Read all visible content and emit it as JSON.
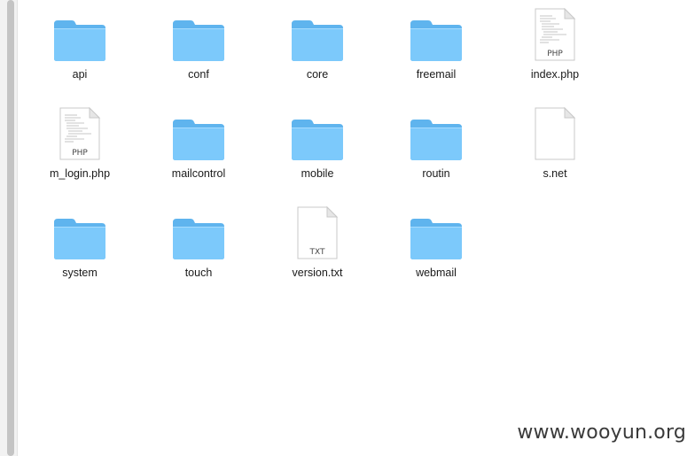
{
  "files": [
    {
      "label": "api",
      "kind": "folder"
    },
    {
      "label": "conf",
      "kind": "folder"
    },
    {
      "label": "core",
      "kind": "folder"
    },
    {
      "label": "freemail",
      "kind": "folder"
    },
    {
      "label": "index.php",
      "kind": "php",
      "badge": "PHP"
    },
    {
      "label": "m_login.php",
      "kind": "php",
      "badge": "PHP"
    },
    {
      "label": "mailcontrol",
      "kind": "folder"
    },
    {
      "label": "mobile",
      "kind": "folder"
    },
    {
      "label": "routin",
      "kind": "folder"
    },
    {
      "label": "s.net",
      "kind": "blank"
    },
    {
      "label": "system",
      "kind": "folder"
    },
    {
      "label": "touch",
      "kind": "folder"
    },
    {
      "label": "version.txt",
      "kind": "txt",
      "badge": "TXT"
    },
    {
      "label": "webmail",
      "kind": "folder"
    }
  ],
  "watermark": "www.wooyun.org",
  "colors": {
    "folder_front": "#7cc9fb",
    "folder_back": "#5fb4ee",
    "label_text": "#1a1a1a"
  }
}
